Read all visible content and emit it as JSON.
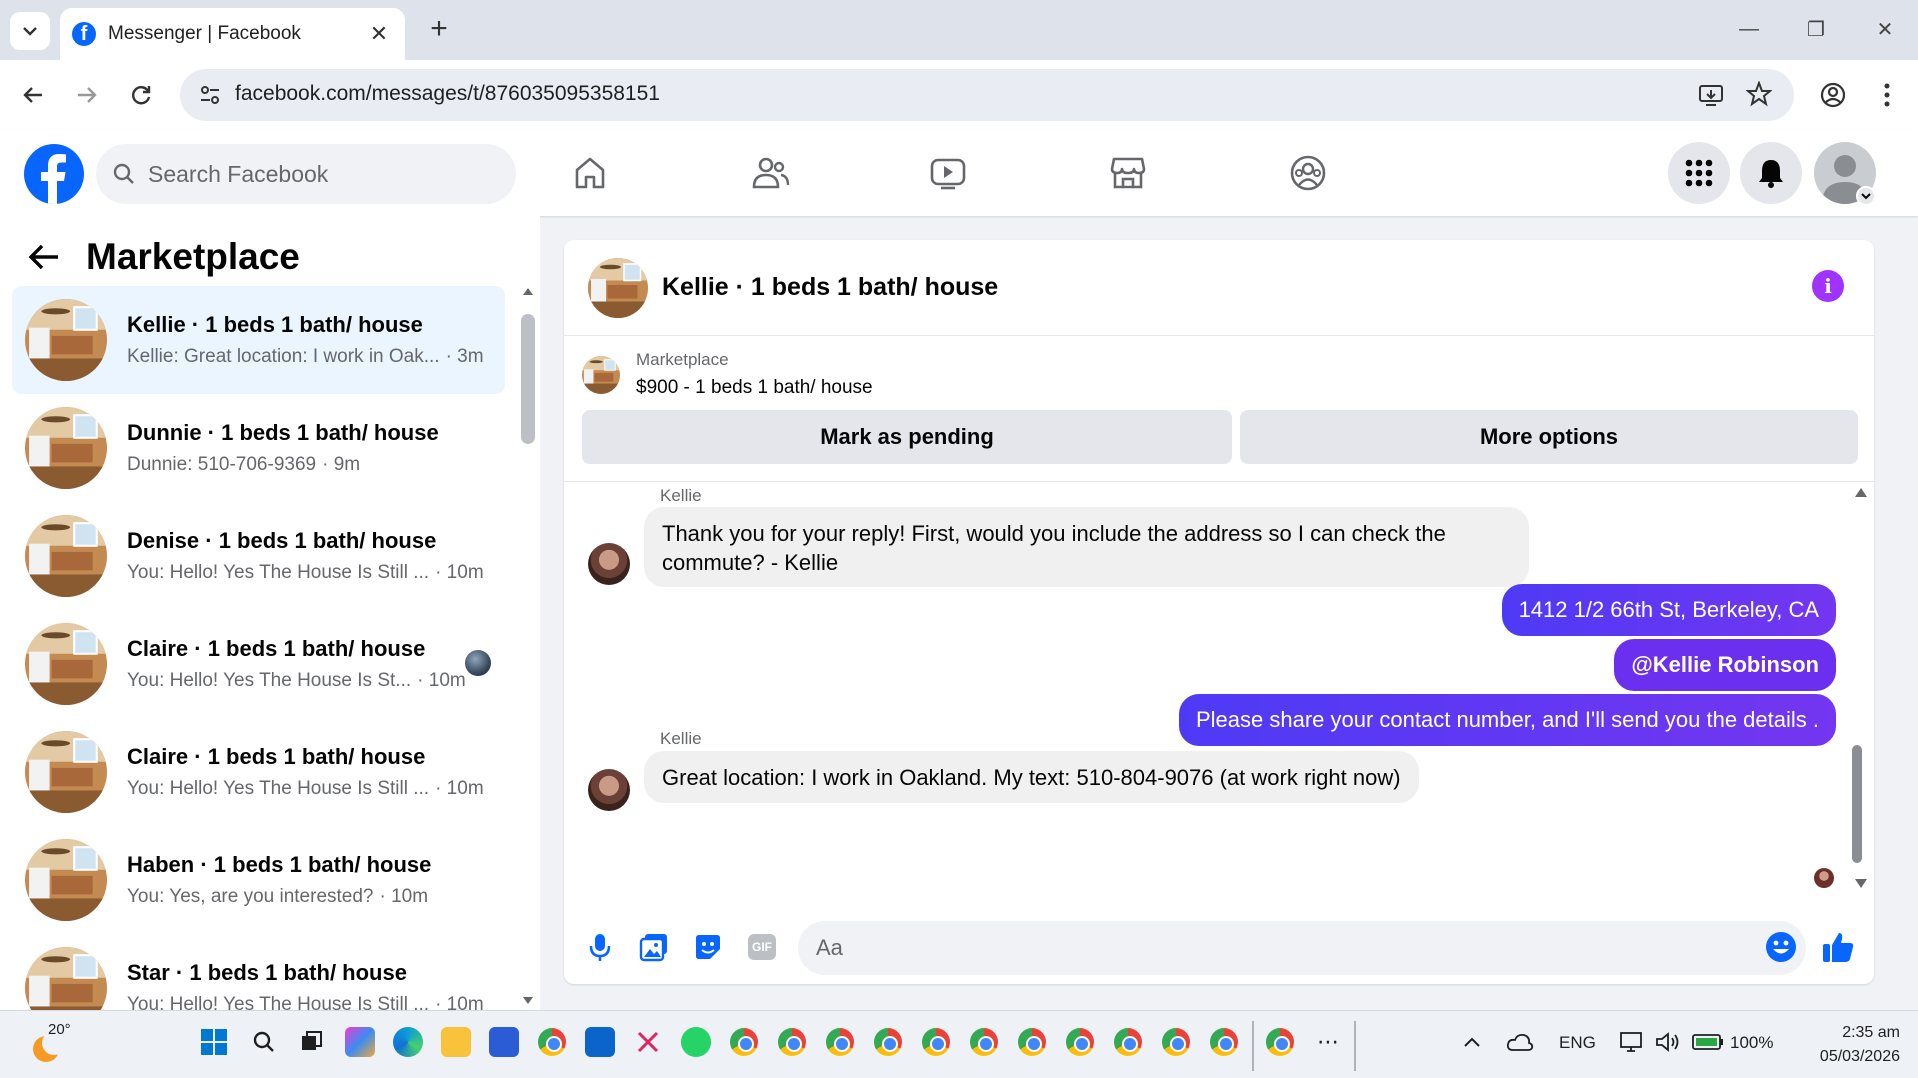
{
  "browser": {
    "tab_title": "Messenger | Facebook",
    "url": "facebook.com/messages/t/876035095358151"
  },
  "facebook": {
    "search_placeholder": "Search Facebook"
  },
  "sidebar": {
    "title": "Marketplace",
    "conversations": [
      {
        "name": "Kellie · 1 beds 1 bath/ house",
        "snippet": "Kellie: Great location: I work in Oak...",
        "time": "· 3m",
        "active": true
      },
      {
        "name": "Dunnie · 1 beds 1 bath/ house",
        "snippet": "Dunnie: 510-706-9369",
        "time": "· 9m"
      },
      {
        "name": "Denise · 1 beds 1 bath/ house",
        "snippet": "You: Hello! Yes The House Is Still ...",
        "time": "· 10m"
      },
      {
        "name": "Claire · 1 beds 1 bath/ house",
        "snippet": "You: Hello! Yes The House Is St...",
        "time": "· 10m"
      },
      {
        "name": "Claire · 1 beds 1 bath/ house",
        "snippet": "You: Hello! Yes The House Is Still ...",
        "time": "· 10m"
      },
      {
        "name": "Haben · 1 beds 1 bath/ house",
        "snippet": "You: Yes, are you interested?",
        "time": "· 10m"
      },
      {
        "name": "Star · 1 beds 1 bath/ house",
        "snippet": "You: Hello! Yes The House Is Still ...",
        "time": "· 10m"
      }
    ]
  },
  "chat": {
    "title": "Kellie · 1 beds 1 bath/ house",
    "listing_label": "Marketplace",
    "listing_price": "$900 - 1 beds 1 bath/ house",
    "mark_pending": "Mark as pending",
    "more_options": "More options",
    "messages": [
      {
        "sender": "Kellie",
        "text_line1": "Thank you for your reply!  First, would you include the address so I can check the",
        "text_line2": "commute? - Kellie"
      },
      {
        "out": "1412 1/2 66th St, Berkeley, CA"
      },
      {
        "out": "@Kellie Robinson"
      },
      {
        "out": "Please share your contact number, and I'll send you the details ."
      },
      {
        "sender": "Kellie",
        "text": "Great location: I work in Oakland. My text: 510-804-9076 (at work right now)"
      }
    ],
    "composer_placeholder": "Aa"
  },
  "taskbar": {
    "weather": "20°",
    "lang": "ENG",
    "battery": "100%",
    "time": "2:35 am",
    "date": "05/03/2026"
  },
  "colors": {
    "fb_blue": "#0866ff",
    "outgoing_bubble": "#5b3af2",
    "info_purple": "#a033ff"
  }
}
